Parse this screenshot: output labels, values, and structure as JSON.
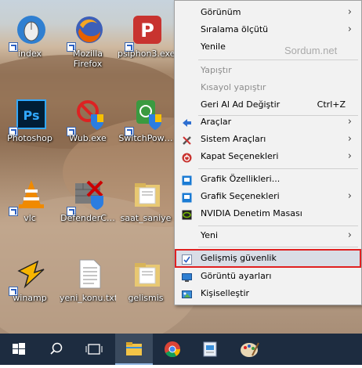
{
  "desktop": {
    "icons": [
      {
        "name": "index",
        "label": "index",
        "color": "#2f7fd1"
      },
      {
        "name": "mozilla-firefox",
        "label": "Mozilla\nFirefox",
        "color": "#e66000"
      },
      {
        "name": "psiphon3",
        "label": "psiphon3.exe",
        "color": "#c8332f"
      },
      {
        "name": "photoshop",
        "label": "Photoshop",
        "color": "#001e36"
      },
      {
        "name": "wub",
        "label": "Wub.exe",
        "color": "#2b7de0"
      },
      {
        "name": "switchpower",
        "label": "SwitchPow…",
        "color": "#3a9a40"
      },
      {
        "name": "vlc",
        "label": "vlc",
        "color": "#f08a00"
      },
      {
        "name": "defenderc",
        "label": "DefenderC…",
        "color": "#7a7a7a"
      },
      {
        "name": "saat-saniye",
        "label": "saat_saniye",
        "color": "#e8c872"
      },
      {
        "name": "winamp",
        "label": "winamp",
        "color": "#f7b500"
      },
      {
        "name": "yeni-konu",
        "label": "yeni_konu.txt",
        "color": "#ffffff"
      },
      {
        "name": "gelismis",
        "label": "gelismis",
        "color": "#e8c872"
      }
    ]
  },
  "menu": {
    "watermark": "Sordum.net",
    "items": [
      {
        "label": "Görünüm",
        "submenu": "›"
      },
      {
        "label": "Sıralama ölçütü",
        "submenu": "›"
      },
      {
        "label": "Yenile"
      },
      {
        "label": "Yapıştır"
      },
      {
        "label": "Kısayol yapıştır"
      },
      {
        "label": "Geri Al Ad Değiştir",
        "shortcut": "Ctrl+Z"
      },
      {
        "label": "Araçlar",
        "submenu": "›"
      },
      {
        "label": "Sistem Araçları",
        "submenu": "›"
      },
      {
        "label": "Kapat Seçenekleri",
        "submenu": "›"
      },
      {
        "label": "Grafik Özellikleri..."
      },
      {
        "label": "Grafik Seçenekleri",
        "submenu": "›"
      },
      {
        "label": "NVIDIA Denetim Masası"
      },
      {
        "label": "Yeni",
        "submenu": "›"
      },
      {
        "label": "Gelişmiş güvenlik"
      },
      {
        "label": "Görüntü ayarları"
      },
      {
        "label": "Kişiselleştir"
      }
    ]
  },
  "taskbar": {
    "items": [
      "start-button",
      "search-icon",
      "task-view-icon",
      "file-explorer-icon",
      "chrome-icon",
      "app-icon",
      "paint-icon"
    ]
  }
}
